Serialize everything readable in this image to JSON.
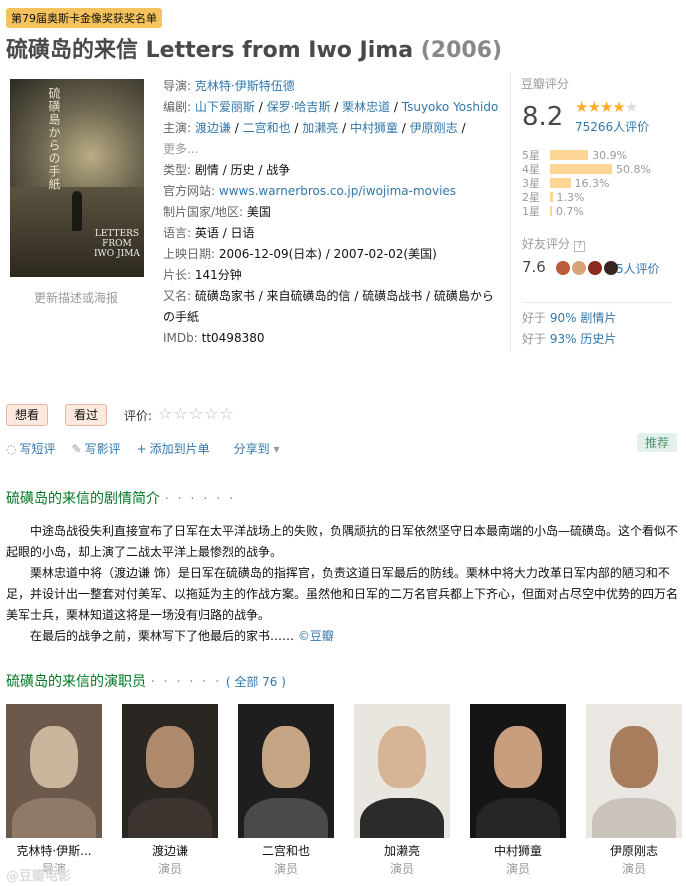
{
  "award_tag": "第79届奥斯卡金像奖获奖名单",
  "title": {
    "main": "硫磺岛的来信 Letters from Iwo Jima",
    "year": "(2006)"
  },
  "poster": {
    "vertical_text": "硫磺島からの手紙",
    "english_text_line1": "LETTERS",
    "english_text_line2": "FROM",
    "english_text_line3": "IWO JIMA",
    "update_link": "更新描述或海报"
  },
  "info": {
    "director_label": "导演:",
    "director": "克林特·伊斯特伍德",
    "writer_label": "编剧:",
    "writer_1": "山下爱丽斯",
    "writer_2": "保罗·哈吉斯",
    "writer_3": "栗林忠道",
    "writer_4": "Tsuyoko Yoshido",
    "cast_label": "主演:",
    "cast_1": "渡边谦",
    "cast_2": "二宫和也",
    "cast_3": "加濑亮",
    "cast_4": "中村狮童",
    "cast_5": "伊原刚志",
    "cast_more": "更多...",
    "genre_label": "类型:",
    "genre": "剧情 / 历史 / 战争",
    "site_label": "官方网站:",
    "site": "wwws.warnerbros.co.jp/iwojima-movies",
    "country_label": "制片国家/地区:",
    "country": "美国",
    "language_label": "语言:",
    "language": "英语 / 日语",
    "release_label": "上映日期:",
    "release": "2006-12-09(日本) / 2007-02-02(美国)",
    "runtime_label": "片长:",
    "runtime": "141分钟",
    "aka_label": "又名:",
    "aka": "硫磺岛家书 / 来自硫磺岛的信 / 硫磺岛战书 / 硫磺島からの手紙",
    "imdb_label": "IMDb:",
    "imdb": "tt0498380"
  },
  "rating": {
    "title": "豆瓣评分",
    "score": "8.2",
    "stars_on": "★★★★",
    "stars_off": "★",
    "votes": "75266人评价",
    "distribution": [
      {
        "label": "5星",
        "percent": 30.9,
        "text": "30.9%"
      },
      {
        "label": "4星",
        "percent": 50.8,
        "text": "50.8%"
      },
      {
        "label": "3星",
        "percent": 16.3,
        "text": "16.3%"
      },
      {
        "label": "2星",
        "percent": 1.3,
        "text": "1.3%"
      },
      {
        "label": "1星",
        "percent": 0.7,
        "text": "0.7%"
      }
    ],
    "friend_title": "好友评分",
    "friend_help": "?",
    "friend_score": "7.6",
    "friend_count": "5人评价",
    "better_1_prefix": "好于",
    "better_1_link": "90% 剧情片",
    "better_2_prefix": "好于",
    "better_2_link": "93% 历史片"
  },
  "buttons": {
    "want": "想看",
    "seen": "看过",
    "rate_label": "评价:",
    "rate_stars": "☆☆☆☆☆"
  },
  "actions": {
    "short_review": "写短评",
    "review": "写影评",
    "add_list": "添加到片单",
    "share": "分享到",
    "recommend": "推荐"
  },
  "synopsis": {
    "heading": "硫磺岛的来信的剧情简介",
    "dots": "· · · · · ·",
    "p1": "中途岛战役失利直接宣布了日军在太平洋战场上的失败，负隅顽抗的日军依然坚守日本最南端的小岛—硫磺岛。这个看似不起眼的小岛，却上演了二战太平洋上最惨烈的战争。",
    "p2": "栗林忠道中将（渡边谦 饰）是日军在硫磺岛的指挥官，负责这道日军最后的防线。栗林中将大力改革日军内部的陋习和不足，并设计出一整套对付美军、以拖延为主的作战方案。虽然他和日军的二万名官兵都上下齐心，但面对占尽空中优势的四万名美军士兵，栗林知道这将是一场没有归路的战争。",
    "p3_text": "在最后的战争之前，栗林写下了他最后的家书……",
    "p3_link": "©豆瓣"
  },
  "cast_section": {
    "heading": "硫磺岛的来信的演职员",
    "dots": "· · · · · ·",
    "all_link": "( 全部 76 )",
    "members": [
      {
        "name": "克林特·伊斯...",
        "role": "导演"
      },
      {
        "name": "渡边谦",
        "role": "演员"
      },
      {
        "name": "二宫和也",
        "role": "演员"
      },
      {
        "name": "加濑亮",
        "role": "演员"
      },
      {
        "name": "中村狮童",
        "role": "演员"
      },
      {
        "name": "伊原刚志",
        "role": "演员"
      }
    ]
  },
  "watermark": "@豆瓣电影",
  "colors": {
    "link": "#3377aa",
    "section_heading": "#007722",
    "star": "#ffac2d",
    "bar": "#ffd596",
    "button_bg": "#fbe9de",
    "award_tag": "#f5c35d"
  }
}
